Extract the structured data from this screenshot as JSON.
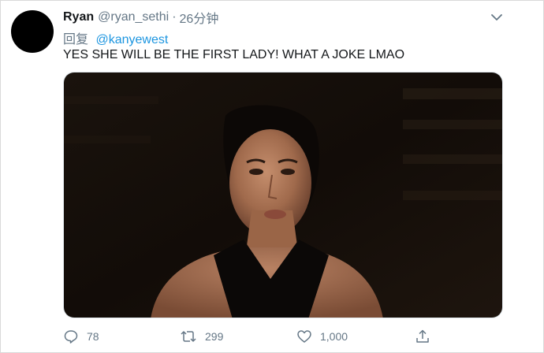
{
  "tweet": {
    "author_name": "Ryan",
    "author_handle": "@ryan_sethi",
    "separator": "·",
    "time": "26分钟",
    "reply_label": "回复",
    "reply_to": "@kanyewest",
    "text": "YES SHE WILL BE THE FIRST LADY! WHAT A JOKE LMAO"
  },
  "actions": {
    "reply_count": "78",
    "retweet_count": "299",
    "like_count": "1,000"
  },
  "icons": {
    "menu": "chevron-down-icon",
    "reply": "speech-bubble-icon",
    "retweet": "retweet-arrows-icon",
    "like": "heart-icon",
    "share": "share-upload-icon"
  },
  "colors": {
    "text": "#14171a",
    "secondary": "#657786",
    "link": "#1b95e0",
    "avatar": "#000000"
  }
}
